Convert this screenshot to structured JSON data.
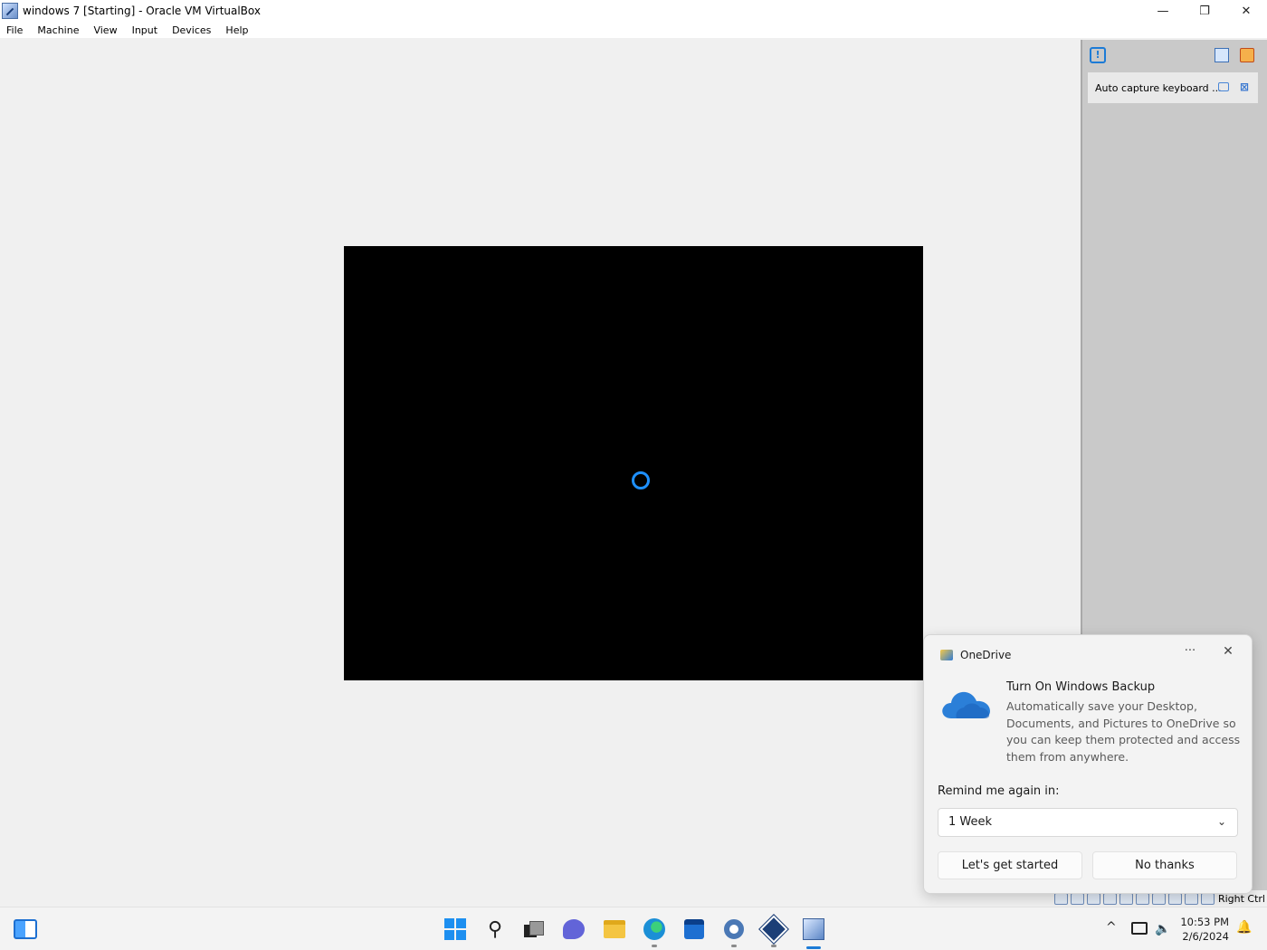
{
  "window": {
    "title": "windows 7 [Starting] - Oracle VM VirtualBox",
    "controls": {
      "minimize": "—",
      "restore": "❐",
      "close": "✕"
    }
  },
  "menu": [
    "File",
    "Machine",
    "View",
    "Input",
    "Devices",
    "Help"
  ],
  "side_panel": {
    "notice_text": "Auto capture keyboard ..."
  },
  "statusbar": {
    "host_key": "Right Ctrl"
  },
  "toast": {
    "app_name": "OneDrive",
    "more": "···",
    "close": "✕",
    "heading": "Turn On Windows Backup",
    "body": "Automatically save your Desktop, Documents, and Pictures to OneDrive so you can keep them protected and access them from anywhere.",
    "remind_label": "Remind me again in:",
    "remind_value": "1 Week",
    "chevron": "⌄",
    "primary_button": "Let's get started",
    "secondary_button": "No thanks",
    "colors": {
      "cloud": "#2b7fd8"
    }
  },
  "taskbar": {
    "apps": [
      "start",
      "search",
      "task-view",
      "chat",
      "file-explorer",
      "edge",
      "store",
      "settings",
      "virtualbox",
      "virtualbox-vm"
    ],
    "tray_chevron": "^",
    "time": "10:53 PM",
    "date": "2/6/2024"
  }
}
